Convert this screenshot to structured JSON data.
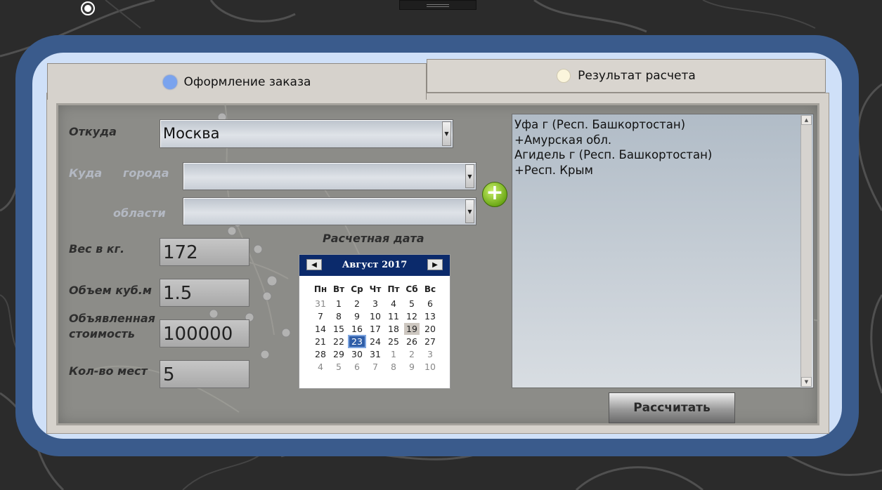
{
  "tabs": {
    "order_label": "Оформление заказа",
    "result_label": "Результат расчета"
  },
  "form": {
    "from_label": "Откуда",
    "from_value": "Москва",
    "to_label": "Куда",
    "cities_label": "города",
    "cities_value": "",
    "regions_label": "области",
    "regions_value": "",
    "weight_label": "Вес в кг.",
    "weight_value": "172",
    "volume_label": "Объем куб.м",
    "volume_value": "1.5",
    "declared_label_1": "Объявленная",
    "declared_label_2": "стоимость",
    "declared_value": "100000",
    "places_label": "Кол-во мест",
    "places_value": "5",
    "calc_date_label": "Расчетная дата"
  },
  "calendar": {
    "title": "Август 2017",
    "weekdays": [
      "Пн",
      "Вт",
      "Ср",
      "Чт",
      "Пт",
      "Сб",
      "Вс"
    ],
    "weeks": [
      [
        "31",
        "1",
        "2",
        "3",
        "4",
        "5",
        "6"
      ],
      [
        "7",
        "8",
        "9",
        "10",
        "11",
        "12",
        "13"
      ],
      [
        "14",
        "15",
        "16",
        "17",
        "18",
        "19",
        "20"
      ],
      [
        "21",
        "22",
        "23",
        "24",
        "25",
        "26",
        "27"
      ],
      [
        "28",
        "29",
        "30",
        "31",
        "1",
        "2",
        "3"
      ],
      [
        "4",
        "5",
        "6",
        "7",
        "8",
        "9",
        "10"
      ]
    ],
    "selected": "23",
    "today": "19"
  },
  "results": {
    "items": [
      "Уфа г (Респ. Башкортостан)",
      "+Амурская обл.",
      "Агидель г (Респ. Башкортостан)",
      "+Респ. Крым"
    ]
  },
  "buttons": {
    "calculate": "Рассчитать"
  },
  "colors": {
    "frame": "#3a5b8c",
    "calendar_header": "#0b2a6b",
    "add_button": "#6eaa18",
    "selected_date": "#2f5ea8"
  }
}
